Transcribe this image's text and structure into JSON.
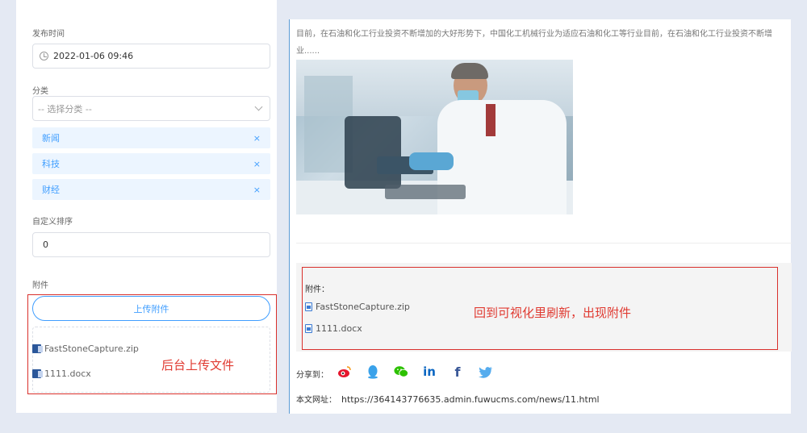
{
  "form": {
    "publish_time_label": "发布时间",
    "publish_time_value": "2022-01-06 09:46",
    "category_label": "分类",
    "category_placeholder": "-- 选择分类 --",
    "tags": [
      "新闻",
      "科技",
      "财经"
    ],
    "tag_remove": "×",
    "sort_label": "自定义排序",
    "sort_value": "0",
    "attachment_label": "附件",
    "upload_button": "上传附件",
    "files": [
      "FastStoneCapture.zip",
      "1111.docx"
    ]
  },
  "article": {
    "text_line1": "目前，在石油和化工行业投资不断增加的大好形势下，中国化工机械行业为适应石油和化工等行业目前，在石油和化工行业投资不断增",
    "text_line2": "业......",
    "attachment_title": "附件：",
    "files": [
      "FastStoneCapture.zip",
      "1111.docx"
    ],
    "share_label": "分享到：",
    "share_icons": [
      "weibo-icon",
      "qq-icon",
      "wechat-icon",
      "linkedin-icon",
      "facebook-icon",
      "twitter-icon"
    ],
    "url_label": "本文网址：",
    "url_value": "https://364143776635.admin.fuwucms.com/news/11.html"
  },
  "annotations": {
    "left_note": "后台上传文件",
    "right_note": "回到可视化里刷新，出现附件"
  },
  "colors": {
    "accent": "#409eff",
    "annotation": "#d9302c"
  }
}
